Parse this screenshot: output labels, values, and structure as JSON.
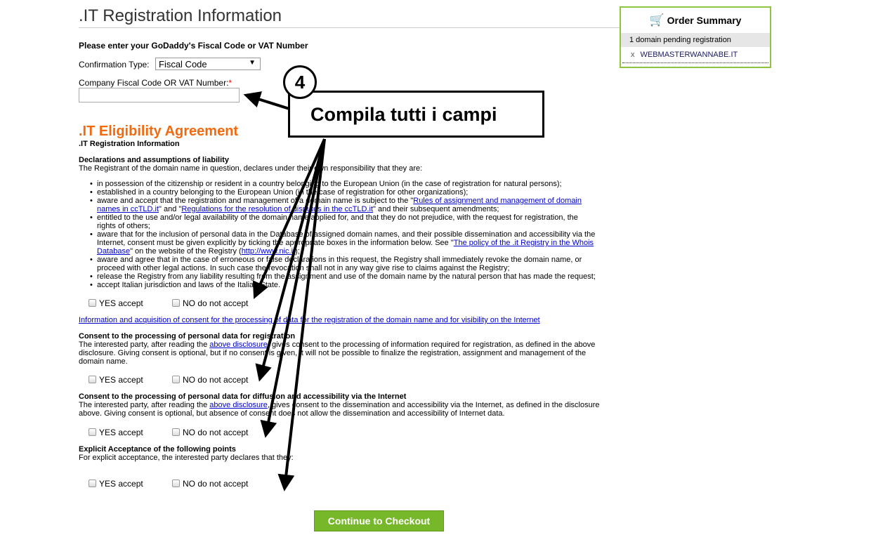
{
  "page_title": ".IT Registration Information",
  "fiscal_heading": "Please enter your GoDaddy's Fiscal Code or VAT Number",
  "confirmation_label": "Confirmation Type:",
  "confirmation_value": "Fiscal Code",
  "fiscal_field_label": "Company Fiscal Code OR VAT Number:",
  "required_mark": "*",
  "fiscal_field_value": "",
  "agreement_title": ".IT Eligibility Agreement",
  "agreement_subtitle": ".IT Registration Information",
  "declarations": {
    "heading": "Declarations and assumptions of liability",
    "intro": "The Registrant of the domain name in question, declares under their own responsibility that they are:",
    "b1": "in possession of the citizenship or resident in a country belonging to the European Union (in the case of registration for natural persons);",
    "b2": "established in a country belonging to the European Union (in the case of registration for other organizations);",
    "b3a": "aware and accept that the registration and management of a domain name is subject to the \"",
    "b3link1": "Rules of assignment and management of domain names in ccTLD.it",
    "b3b": "\" and \"",
    "b3link2": "Regulations for the resolution of disputes in the ccTLD.it",
    "b3c": "\" and their subsequent amendments;",
    "b4": "entitled to the use and/or legal availability of the domain name applied for, and that they do not prejudice, with the request for registration, the rights of others;",
    "b5a": "aware that for the inclusion of personal data in the Database of assigned domain names, and their possible dissemination and accessibility via the Internet, consent must be given explicitly by ticking the appropriate boxes in the information below. See \"",
    "b5link": "The policy of the .it Registry in the Whois Database",
    "b5b": "\" on the website of the Registry (",
    "b5link2": "http://www.nic.it",
    "b5c": ");",
    "b6": "aware and agree that in the case of erroneous or false declarations in this request, the Registry shall immediately revoke the domain name, or proceed with other legal actions. In such case the revocation shall not in any way give rise to claims against the Registry;",
    "b7": "release the Registry from any liability resulting from the assignment and use of the domain name by the natural person that has made the request;",
    "b8": "accept Italian jurisdiction and laws of the Italian State."
  },
  "yes_label": "YES accept",
  "no_label": "NO do not accept",
  "info_link": "Information and acquisition of consent for the processing of data for the registration of the domain name and for visibility on the Internet",
  "consent1": {
    "heading": "Consent to the processing of personal data for registration",
    "a": "The interested party, after reading the ",
    "link": "above disclosure",
    "b": ", gives consent to the processing of information required for registration, as defined in the above disclosure. Giving consent is optional, but if no consent is given, it will not be possible to finalize the registration, assignment and management of the domain name."
  },
  "consent2": {
    "heading": "Consent to the processing of personal data for diffusion and accessibility via the Internet",
    "a": "The interested party, after reading the ",
    "link": "above disclosure",
    "b": ", gives consent to the dissemination and accessibility via the Internet, as defined in the disclosure above. Giving consent is optional, but absence of consent does not allow the dissemination and accessibility of Internet data."
  },
  "explicit": {
    "heading": "Explicit Acceptance of the following points",
    "text": "For explicit acceptance, the interested party declares that they:"
  },
  "continue_label": "Continue to Checkout",
  "order": {
    "title": "Order Summary",
    "pending": "1 domain pending registration",
    "remove": "x",
    "domain": "WEBMASTERWANNABE.IT",
    "icon": "cart-icon"
  },
  "annotation": {
    "step": "4",
    "text": "Compila tutti i campi"
  },
  "colors": {
    "accent_orange": "#f26a10",
    "button_green": "#77b82a",
    "order_border": "#8cc63f",
    "link": "#0000cc"
  }
}
